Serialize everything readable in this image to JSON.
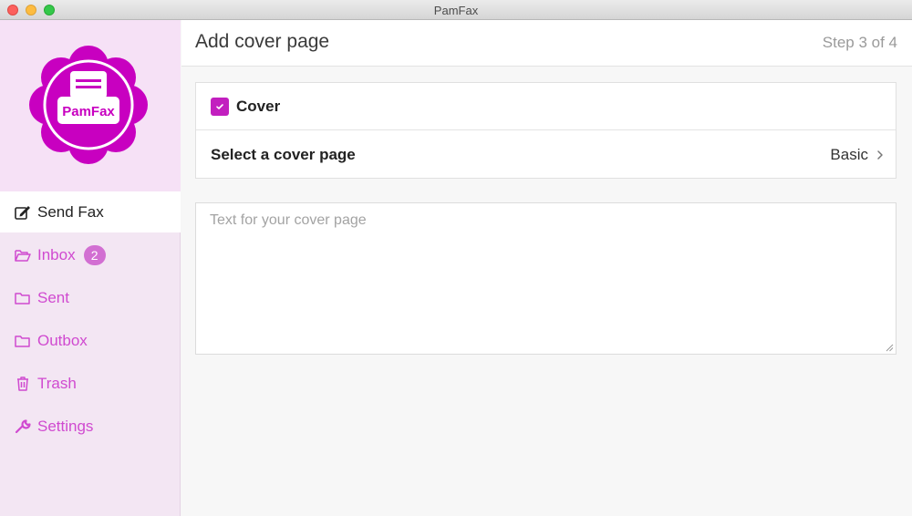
{
  "window": {
    "title": "PamFax"
  },
  "logo": {
    "text": "PamFax",
    "color": "#c800c0"
  },
  "sidebar": {
    "items": [
      {
        "label": "Send Fax",
        "icon": "edit-icon",
        "active": true
      },
      {
        "label": "Inbox",
        "icon": "folder-open-icon",
        "badge": "2"
      },
      {
        "label": "Sent",
        "icon": "folder-icon"
      },
      {
        "label": "Outbox",
        "icon": "folder-icon"
      },
      {
        "label": "Trash",
        "icon": "trash-icon"
      },
      {
        "label": "Settings",
        "icon": "wrench-icon"
      }
    ]
  },
  "header": {
    "title": "Add cover page",
    "step": "Step 3 of 4"
  },
  "cover": {
    "checkbox_label": "Cover",
    "checked": true,
    "select_label": "Select a cover page",
    "select_value": "Basic"
  },
  "cover_text": {
    "placeholder": "Text for your cover page",
    "value": ""
  },
  "colors": {
    "accent": "#c21fbf",
    "sidebar_text": "#d04ad0",
    "sidebar_bg": "#f3e6f3"
  }
}
